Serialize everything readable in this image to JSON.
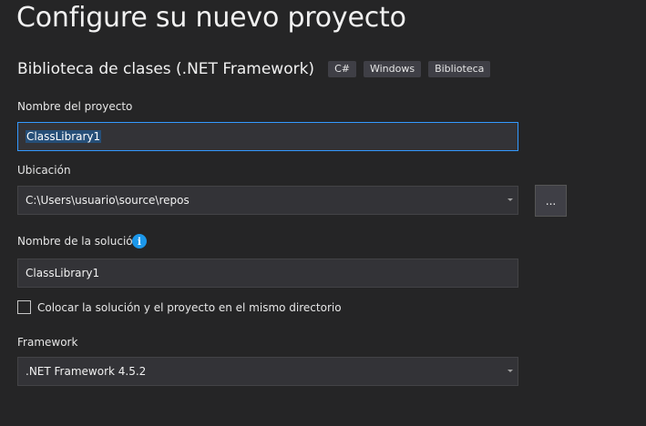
{
  "header": {
    "title": "Configure su nuevo proyecto",
    "subtitle": "Biblioteca de clases (.NET Framework)",
    "tags": [
      "C#",
      "Windows",
      "Biblioteca"
    ]
  },
  "project_name": {
    "label": "Nombre del proyecto",
    "value": "ClassLibrary1"
  },
  "location": {
    "label": "Ubicación",
    "value": "C:\\Users\\usuario\\source\\repos",
    "browse_label": "..."
  },
  "solution_name": {
    "label": "Nombre de la solución",
    "value": "ClassLibrary1",
    "info_icon": "i"
  },
  "same_directory": {
    "label": "Colocar la solución y el proyecto en el mismo directorio",
    "checked": false
  },
  "framework": {
    "label": "Framework",
    "value": ".NET Framework 4.5.2"
  },
  "colors": {
    "background": "#252526",
    "accent": "#3399ff",
    "info": "#1c97ea"
  }
}
